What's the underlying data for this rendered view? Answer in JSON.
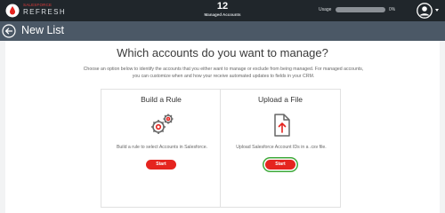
{
  "app": {
    "brand_small": "SALESFORCE",
    "brand_name": "REFRESH",
    "managed_count": "12",
    "managed_label": "Managed Accounts",
    "usage_label": "Usage",
    "usage_fraction": 0,
    "usage_percent_text": "0%"
  },
  "page": {
    "title": "New List",
    "heading": "Which accounts do you want to manage?",
    "description": "Choose an option below to identify the accounts that you either want to manage or exclude from being managed. For managed accounts, you can customize when and how your receive automated updates to fields in your CRM."
  },
  "options": {
    "rule": {
      "title": "Build a Rule",
      "text": "Build a rule to select Accounts in Salesforce.",
      "button": "Start",
      "icon": "gears-icon"
    },
    "upload": {
      "title": "Upload a File",
      "text": "Upload Salesforce Account IDs in a .csv file.",
      "button": "Start",
      "icon": "upload-file-icon"
    }
  },
  "colors": {
    "topbar": "#20262b",
    "header": "#4b5866",
    "accent_red": "#e5241f",
    "highlight_green": "#3fa83a"
  }
}
